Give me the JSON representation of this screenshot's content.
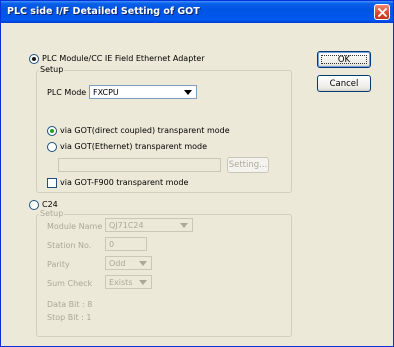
{
  "window": {
    "title": "PLC side I/F Detailed Setting of GOT"
  },
  "buttons": {
    "ok": "OK",
    "cancel": "Cancel",
    "setting": "Setting..."
  },
  "ethernet": {
    "radio_label": "PLC Module/CC IE Field Ethernet Adapter",
    "group_label": "Setup",
    "plc_mode_label": "PLC Mode",
    "plc_mode_value": "FXCPU",
    "mode_direct": "via GOT(direct coupled) transparent mode",
    "mode_ethernet": "via GOT(Ethernet) transparent mode",
    "ip_value": "",
    "f900_label": "via GOT-F900 transparent mode"
  },
  "c24": {
    "radio_label": "C24",
    "group_label": "Setup",
    "module_name_label": "Module Name",
    "module_name_value": "QJ71C24",
    "station_label": "Station No.",
    "station_value": "0",
    "parity_label": "Parity",
    "parity_value": "Odd",
    "sum_check_label": "Sum Check",
    "sum_check_value": "Exists",
    "data_bit": "Data Bit : 8",
    "stop_bit": "Stop Bit : 1"
  },
  "colors": {
    "titlebar": "#0054e3",
    "dialog_bg": "#ece9d8",
    "radio_dot": "#21a121",
    "close_button": "#d8472a"
  }
}
